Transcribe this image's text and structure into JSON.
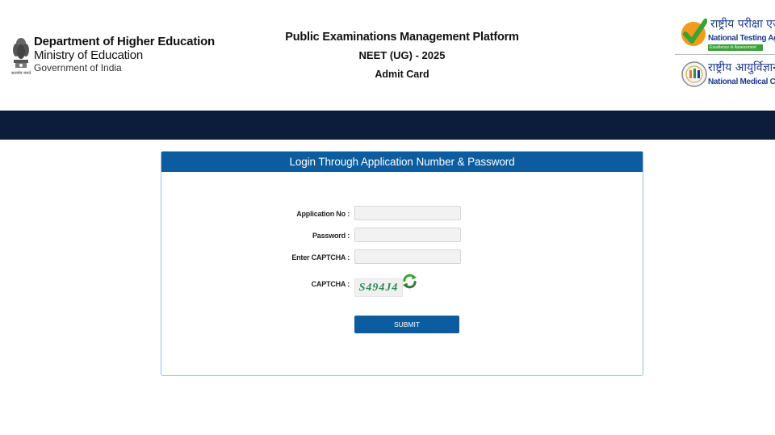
{
  "header": {
    "department": "Department of Higher Education",
    "ministry": "Ministry of Education",
    "government": "Government of India",
    "emblem_caption": "सत्यमेव जयते",
    "platform_title": "Public Examinations Management Platform",
    "exam_title": "NEET (UG) - 2025",
    "page_subtitle": "Admit Card",
    "nta_hindi": "राष्ट्रीय परीक्षा एजेंसी",
    "nta_name": "National Testing Agency",
    "nta_tagline": "Excellence in Assessment",
    "nmc_hindi": "राष्ट्रीय आयुर्विज्ञान आयोग",
    "nmc_name": "National Medical Commission"
  },
  "colors": {
    "header_band": "#0c1c3b",
    "panel_header": "#0b5d9f",
    "submit_button": "#0b5d9f",
    "nta_green": "#3aa335",
    "logo_blue": "#1b3c8c"
  },
  "login": {
    "title": "Login Through Application Number & Password",
    "application_no_label": "Application No :",
    "application_no_value": "",
    "password_label": "Password :",
    "password_value": "",
    "captcha_input_label": "Enter CAPTCHA :",
    "captcha_input_value": "",
    "captcha_label": "CAPTCHA :",
    "captcha_text": "S494J4",
    "refresh_icon": "refresh-icon",
    "submit_label": "SUBMIT"
  }
}
